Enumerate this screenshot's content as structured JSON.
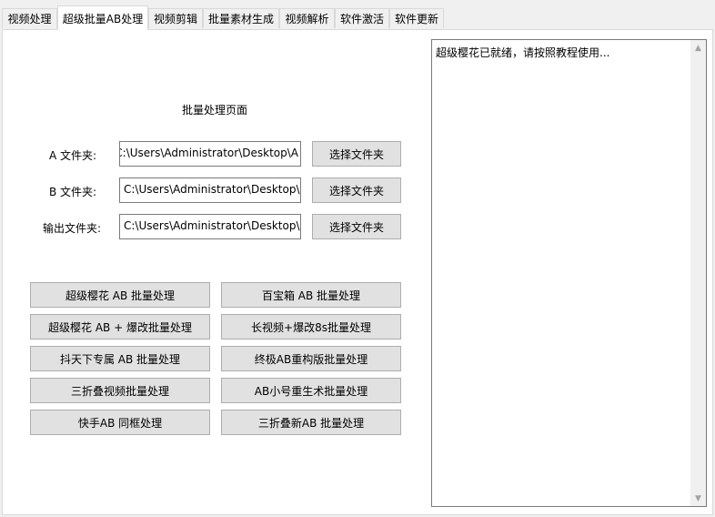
{
  "tabs": [
    {
      "label": "视频处理"
    },
    {
      "label": "超级批量AB处理"
    },
    {
      "label": "视频剪辑"
    },
    {
      "label": "批量素材生成"
    },
    {
      "label": "视频解析"
    },
    {
      "label": "软件激活"
    },
    {
      "label": "软件更新"
    }
  ],
  "panel": {
    "title": "批量处理页面",
    "folders": [
      {
        "label": "A 文件夹:",
        "value": "C:\\Users\\Administrator\\Desktop\\A",
        "button": "选择文件夹"
      },
      {
        "label": "B 文件夹:",
        "value": "C:\\Users\\Administrator\\Desktop\\",
        "button": "选择文件夹"
      },
      {
        "label": "输出文件夹:",
        "value": "C:\\Users\\Administrator\\Desktop\\",
        "button": "选择文件夹"
      }
    ],
    "actions": [
      "超级樱花 AB 批量处理",
      "百宝箱 AB 批量处理",
      "超级樱花 AB + 爆改批量处理",
      "长视频+爆改8s批量处理",
      "抖天下专属 AB 批量处理",
      "终极AB重构版批量处理",
      "三折叠视频批量处理",
      "AB小号重生术批量处理",
      "快手AB 同框处理",
      "三折叠新AB 批量处理"
    ]
  },
  "log": {
    "text": "超级樱花已就绪，请按照教程使用..."
  },
  "icons": {
    "scroll_up": "scroll-up-arrow-icon",
    "scroll_down": "scroll-down-arrow-icon"
  }
}
